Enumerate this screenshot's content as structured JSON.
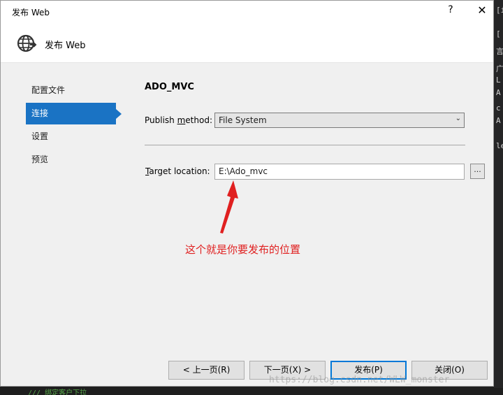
{
  "dialog": {
    "title": "发布 Web",
    "help_glyph": "?",
    "close_glyph": "✕",
    "header_title": "发布 Web"
  },
  "nav": {
    "items": [
      {
        "label": "配置文件",
        "active": false
      },
      {
        "label": "连接",
        "active": true
      },
      {
        "label": "设置",
        "active": false
      },
      {
        "label": "预览",
        "active": false
      }
    ]
  },
  "main": {
    "profile_name": "ADO_MVC",
    "publish_method_label_pre": "Publish ",
    "publish_method_label_ul": "m",
    "publish_method_label_post": "ethod:",
    "publish_method_value": "File System",
    "target_location_label_ul": "T",
    "target_location_label_post": "arget location:",
    "target_location_value": "E:\\Ado_mvc",
    "browse_label": "..."
  },
  "annotation": {
    "text": "这个就是你要发布的位置",
    "color": "#e02020"
  },
  "buttons": {
    "prev": "< 上一页(R)",
    "next": "下一页(X) >",
    "publish": "发布(P)",
    "close": "关闭(O)"
  },
  "watermark": "https://blog.csdn.net/WLW_monster",
  "ide": {
    "bottom_text": "/// 绑定客户下拉",
    "right_chars": [
      "[",
      "[i",
      "言",
      "广",
      "L",
      "A",
      "c",
      "A",
      "le"
    ]
  },
  "colors": {
    "accent": "#1a73c4",
    "annotation": "#e02020"
  }
}
